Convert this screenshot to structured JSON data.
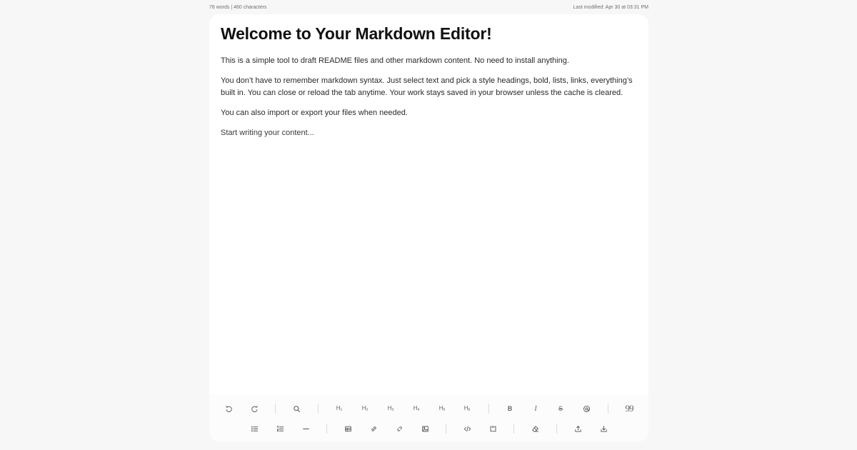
{
  "status": {
    "counts": "78 words | 460 characters",
    "last_modified": "Last modified: Apr 30 at 03:31 PM"
  },
  "document": {
    "heading": "Welcome to Your Markdown Editor!",
    "paragraphs": [
      "This is a simple tool to draft README files and other markdown content. No need to install anything.",
      "You don’t have to remember markdown syntax. Just select text and pick a style headings, bold, lists, links, everything’s built in. You can close or reload the tab anytime. Your work stays saved in your browser unless the cache is cleared.",
      "You can also import or export your files when needed.",
      "Start writing your content..."
    ]
  },
  "toolbar": {
    "row1": [
      {
        "icon": "undo-icon"
      },
      {
        "icon": "redo-icon"
      },
      {
        "icon": "search-icon"
      },
      {
        "label": "H",
        "sub": "1"
      },
      {
        "label": "H",
        "sub": "2"
      },
      {
        "label": "H",
        "sub": "3"
      },
      {
        "label": "H",
        "sub": "4"
      },
      {
        "label": "H",
        "sub": "5"
      },
      {
        "label": "H",
        "sub": "6"
      },
      {
        "label": "B"
      },
      {
        "label": "I"
      },
      {
        "label": "S"
      },
      {
        "icon": "at-sign-icon"
      },
      {
        "label": "99"
      }
    ],
    "row2": [
      {
        "icon": "bullet-list-icon"
      },
      {
        "icon": "numbered-list-icon"
      },
      {
        "icon": "horizontal-rule-icon"
      },
      {
        "icon": "table-icon"
      },
      {
        "icon": "link-icon"
      },
      {
        "icon": "unlink-icon"
      },
      {
        "icon": "image-icon"
      },
      {
        "icon": "code-icon"
      },
      {
        "icon": "code-block-icon"
      },
      {
        "icon": "eraser-icon"
      },
      {
        "icon": "export-icon"
      },
      {
        "icon": "import-icon"
      }
    ]
  }
}
